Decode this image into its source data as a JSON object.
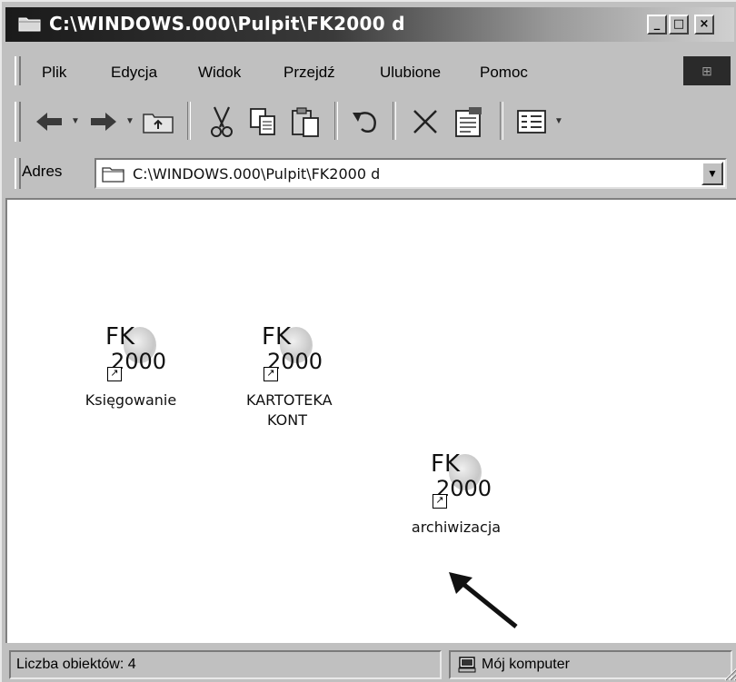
{
  "window": {
    "title": "C:\\WINDOWS.000\\Pulpit\\FK2000 d",
    "buttons": {
      "minimize": "_",
      "maximize": "□",
      "close": "×"
    }
  },
  "menu": {
    "items": [
      {
        "label": "Plik"
      },
      {
        "label": "Edycja"
      },
      {
        "label": "Widok"
      },
      {
        "label": "Przejdź"
      },
      {
        "label": "Ulubione"
      },
      {
        "label": "Pomoc"
      }
    ]
  },
  "toolbar": {
    "icons": [
      "back-icon",
      "forward-icon",
      "up-folder-icon",
      "cut-icon",
      "copy-icon",
      "paste-icon",
      "undo-icon",
      "delete-icon",
      "properties-icon",
      "views-icon"
    ]
  },
  "address": {
    "label": "Adres",
    "value": "C:\\WINDOWS.000\\Pulpit\\FK2000 d"
  },
  "files": [
    {
      "label": "Księgowanie",
      "icon_top": "FK",
      "icon_bottom": "2000"
    },
    {
      "label": "KARTOTEKA KONT",
      "icon_top": "FK",
      "icon_bottom": "2000"
    },
    {
      "label": "archiwizacja",
      "icon_top": "FK",
      "icon_bottom": "2000"
    }
  ],
  "status": {
    "count": "Liczba obiektów: 4",
    "location": "Mój komputer"
  }
}
